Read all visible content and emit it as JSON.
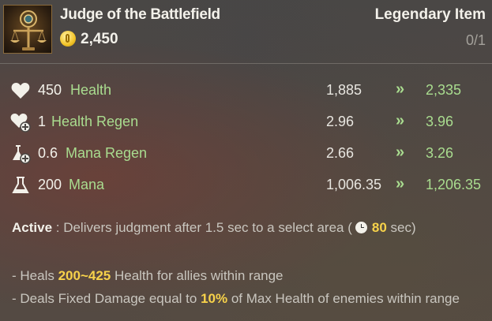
{
  "item": {
    "name": "Judge of the Battlefield",
    "price": "2,450",
    "rarity": "Legendary Item",
    "count": "0/1",
    "icon": "scales-icon",
    "coin_icon": "gold-coin-icon"
  },
  "stats": [
    {
      "icon": "heart-icon",
      "amount": "450",
      "name": "Health",
      "old": "1,885",
      "new": "2,335"
    },
    {
      "icon": "health-regen-icon",
      "amount": "1",
      "name": "Health Regen",
      "old": "2.96",
      "new": "3.96"
    },
    {
      "icon": "mana-regen-icon",
      "amount": "0.6",
      "name": "Mana Regen",
      "old": "2.66",
      "new": "3.26"
    },
    {
      "icon": "flask-icon",
      "amount": "200",
      "name": "Mana",
      "old": "1,006.35",
      "new": "1,206.35"
    }
  ],
  "arrow": "»",
  "active": {
    "label": "Active",
    "text": " : Delivers judgment after 1.5 sec to a select area (",
    "cooldown": "80",
    "suffix": " sec)"
  },
  "effects": [
    {
      "prefix": "- Heals ",
      "highlight": "200~425",
      "suffix": " Health for allies within range"
    },
    {
      "prefix": "- Deals Fixed Damage equal to ",
      "highlight": "10%",
      "suffix": " of Max Health of enemies within range"
    }
  ],
  "colors": {
    "stat_green": "#a9dc8f",
    "highlight_yellow": "#f7d24a",
    "text_white": "#f3f1ea"
  }
}
